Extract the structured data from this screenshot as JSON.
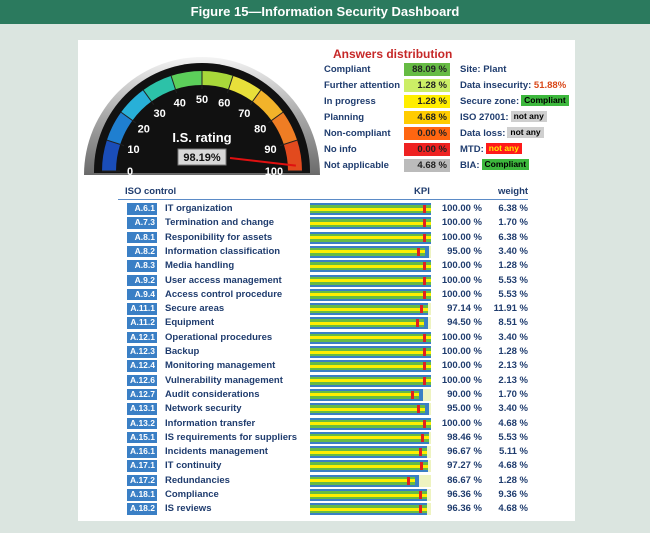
{
  "figure_title": "Figure 15—Information Security Dashboard",
  "gauge": {
    "title": "I.S. rating",
    "value_text": "98.19%",
    "value": 98.19,
    "ticks": [
      "0",
      "10",
      "20",
      "30",
      "40",
      "50",
      "60",
      "70",
      "80",
      "90",
      "100"
    ]
  },
  "answers": {
    "title": "Answers distribution",
    "items": [
      {
        "label": "Compliant",
        "pct": "88.09 %",
        "color": "#66bb44"
      },
      {
        "label": "Further attention",
        "pct": "1.28 %",
        "color": "#ccee66"
      },
      {
        "label": "In progress",
        "pct": "1.28 %",
        "color": "#ffee00"
      },
      {
        "label": "Planning",
        "pct": "4.68 %",
        "color": "#ffcc00"
      },
      {
        "label": "Non-compliant",
        "pct": "0.00 %",
        "color": "#ff6611"
      },
      {
        "label": "No info",
        "pct": "0.00 %",
        "color": "#ee2222"
      },
      {
        "label": "Not applicable",
        "pct": "4.68 %",
        "color": "#bbbbbb"
      }
    ]
  },
  "info": {
    "site": "Site: Plant",
    "data_insecurity_label": "Data insecurity:",
    "data_insecurity_value": "51.88%",
    "secure_zone_label": "Secure zone:",
    "secure_zone_value": "Compliant",
    "iso_label": "ISO 27001:",
    "iso_value": "not any",
    "data_loss_label": "Data loss:",
    "data_loss_value": "not any",
    "mtd_label": "MTD:",
    "mtd_value": "not any",
    "bia_label": "BIA:",
    "bia_value": "Compliant"
  },
  "table": {
    "headers": {
      "control": "ISO control",
      "kpi": "KPI",
      "weight": "weight"
    },
    "rows": [
      {
        "code": "A.6.1",
        "name": "IT organization",
        "kpi": "100.00 %",
        "weight": "6.38 %"
      },
      {
        "code": "A.7.3",
        "name": "Termination and change",
        "kpi": "100.00 %",
        "weight": "1.70 %"
      },
      {
        "code": "A.8.1",
        "name": "Responibility for assets",
        "kpi": "100.00 %",
        "weight": "6.38 %"
      },
      {
        "code": "A.8.2",
        "name": "Information classification",
        "kpi": "95.00 %",
        "weight": "3.40 %"
      },
      {
        "code": "A.8.3",
        "name": "Media handling",
        "kpi": "100.00 %",
        "weight": "1.28 %"
      },
      {
        "code": "A.9.2",
        "name": "User access management",
        "kpi": "100.00 %",
        "weight": "5.53 %"
      },
      {
        "code": "A.9.4",
        "name": "Access control procedure",
        "kpi": "100.00 %",
        "weight": "5.53 %"
      },
      {
        "code": "A.11.1",
        "name": "Secure areas",
        "kpi": "97.14 %",
        "weight": "11.91 %"
      },
      {
        "code": "A.11.2",
        "name": "Equipment",
        "kpi": "94.50 %",
        "weight": "8.51 %"
      },
      {
        "code": "A.12.1",
        "name": "Operational procedures",
        "kpi": "100.00 %",
        "weight": "3.40 %"
      },
      {
        "code": "A.12.3",
        "name": "Backup",
        "kpi": "100.00 %",
        "weight": "1.28 %"
      },
      {
        "code": "A.12.4",
        "name": "Monitoring management",
        "kpi": "100.00 %",
        "weight": "2.13 %"
      },
      {
        "code": "A.12.6",
        "name": "Vulnerability management",
        "kpi": "100.00 %",
        "weight": "2.13 %"
      },
      {
        "code": "A.12.7",
        "name": "Audit considerations",
        "kpi": "90.00 %",
        "weight": "1.70 %"
      },
      {
        "code": "A.13.1",
        "name": "Network security",
        "kpi": "95.00 %",
        "weight": "3.40 %"
      },
      {
        "code": "A.13.2",
        "name": "Information transfer",
        "kpi": "100.00 %",
        "weight": "4.68 %"
      },
      {
        "code": "A.15.1",
        "name": "IS requirements for suppliers",
        "kpi": "98.46 %",
        "weight": "5.53 %"
      },
      {
        "code": "A.16.1",
        "name": "Incidents management",
        "kpi": "96.67 %",
        "weight": "5.11 %"
      },
      {
        "code": "A.17.1",
        "name": "IT continuity",
        "kpi": "97.27 %",
        "weight": "4.68 %"
      },
      {
        "code": "A.17.2",
        "name": "Redundancies",
        "kpi": "86.67 %",
        "weight": "1.28 %"
      },
      {
        "code": "A.18.1",
        "name": "Compliance",
        "kpi": "96.36 %",
        "weight": "9.36 %"
      },
      {
        "code": "A.18.2",
        "name": "IS reviews",
        "kpi": "96.36 %",
        "weight": "4.68 %"
      }
    ]
  }
}
